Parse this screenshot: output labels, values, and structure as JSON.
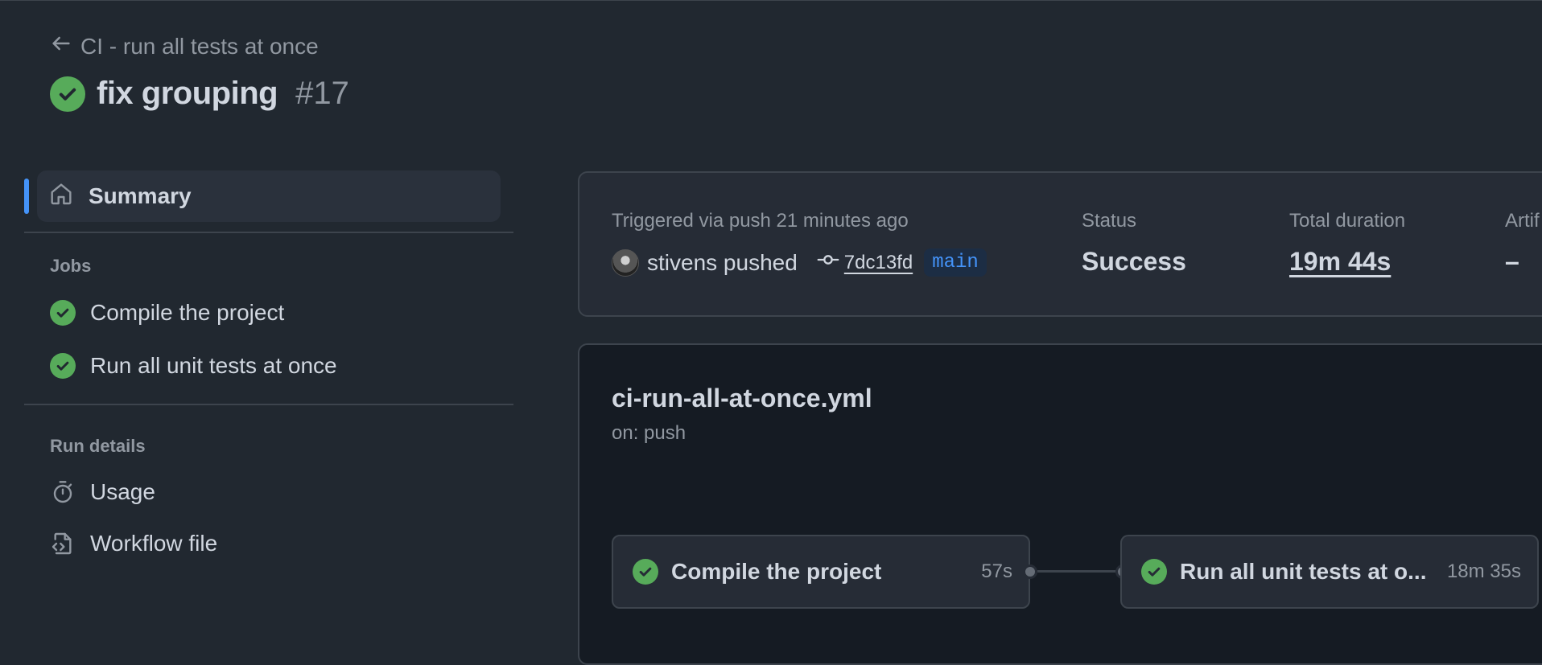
{
  "header": {
    "back_label": "CI - run all tests at once",
    "run_title": "fix grouping",
    "run_number": "#17"
  },
  "sidebar": {
    "summary_label": "Summary",
    "jobs_heading": "Jobs",
    "jobs": [
      {
        "label": "Compile the project",
        "status": "success"
      },
      {
        "label": "Run all unit tests at once",
        "status": "success"
      }
    ],
    "run_details_heading": "Run details",
    "run_details": [
      {
        "label": "Usage",
        "icon": "stopwatch-icon"
      },
      {
        "label": "Workflow file",
        "icon": "file-code-icon"
      }
    ]
  },
  "summary": {
    "triggered_text": "Triggered via push 21 minutes ago",
    "actor": "stivens pushed",
    "commit_sha": "7dc13fd",
    "branch": "main",
    "status_label": "Status",
    "status_value": "Success",
    "duration_label": "Total duration",
    "duration_value": "19m 44s",
    "artifacts_label": "Artif",
    "artifacts_value": "–"
  },
  "workflow": {
    "file_name": "ci-run-all-at-once.yml",
    "trigger": "on: push",
    "jobs": [
      {
        "name": "Compile the project",
        "duration": "57s"
      },
      {
        "name": "Run all unit tests at o...",
        "duration": "18m 35s"
      }
    ]
  },
  "colors": {
    "background": "#212830",
    "success": "#57ab5a",
    "accent": "#4493f8",
    "border": "#3d444d"
  }
}
